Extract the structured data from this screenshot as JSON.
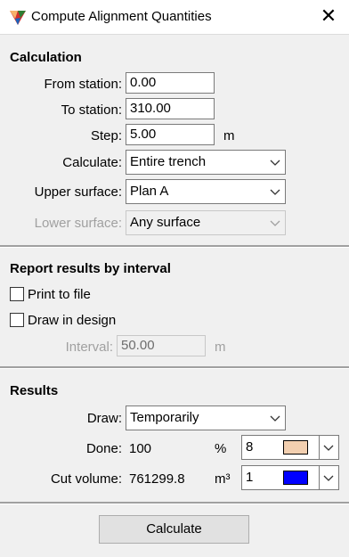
{
  "window": {
    "title": "Compute Alignment Quantities",
    "close_glyph": "✕",
    "app_icon": "trimble-triangle-icon"
  },
  "calculation": {
    "heading": "Calculation",
    "from_station_label": "From station:",
    "from_station_value": "0.00",
    "to_station_label": "To station:",
    "to_station_value": "310.00",
    "step_label": "Step:",
    "step_value": "5.00",
    "step_unit": "m",
    "calculate_label": "Calculate:",
    "calculate_value": "Entire trench",
    "upper_surface_label": "Upper surface:",
    "upper_surface_value": "Plan A",
    "lower_surface_label": "Lower surface:",
    "lower_surface_value": "Any surface"
  },
  "report": {
    "heading": "Report results by interval",
    "print_to_file_label": "Print to file",
    "print_to_file_checked": false,
    "draw_in_design_label": "Draw in design",
    "draw_in_design_checked": false,
    "interval_label": "Interval:",
    "interval_value": "50.00",
    "interval_unit": "m"
  },
  "results": {
    "heading": "Results",
    "draw_label": "Draw:",
    "draw_value": "Temporarily",
    "done_label": "Done:",
    "done_value": "100",
    "done_unit": "%",
    "done_color_index": "8",
    "done_color": "#f2cfb0",
    "cut_volume_label": "Cut volume:",
    "cut_volume_value": "761299.8",
    "cut_volume_unit": "m³",
    "cut_color_index": "1",
    "cut_color": "#0000ff"
  },
  "actions": {
    "calculate_button": "Calculate"
  }
}
